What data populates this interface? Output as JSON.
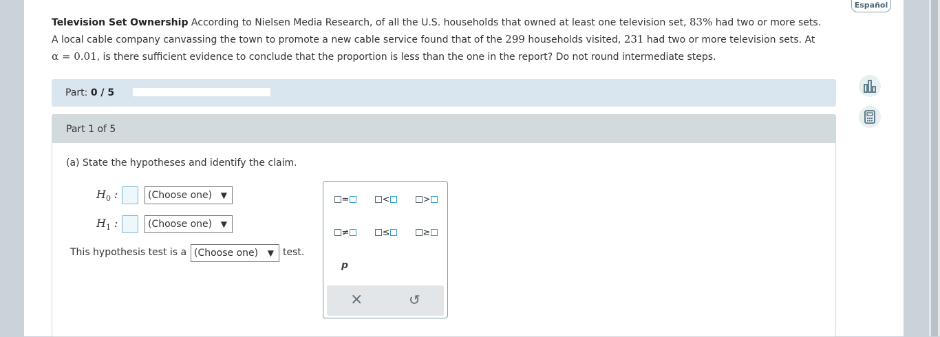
{
  "header": {
    "language_button": "Español"
  },
  "problem": {
    "title": "Television Set Ownership",
    "line1_a": "According to Nielsen Media Research, of all the U.S. households that owned at least one television set,",
    "pct": "83%",
    "line1_b": "had two or more sets.",
    "line2_a": "A local cable company canvassing the town to promote a new cable service found that of the",
    "n": "299",
    "line2_b": "households visited,",
    "x": "231",
    "line2_c": "had two or more television sets. At",
    "alpha": "α = 0.01",
    "line3": ", is there sufficient evidence to conclude that the proportion is less than the one in the report? Do not round intermediate steps."
  },
  "progress": {
    "label": "Part:",
    "value": "0 / 5",
    "fraction": 0
  },
  "section": {
    "title": "Part 1 of 5",
    "question": "(a) State the hypotheses and identify the claim.",
    "h0_label": "H",
    "h0_sub": "0",
    "h1_label": "H",
    "h1_sub": "1",
    "colon": ":",
    "h0_select": "(Choose one)",
    "h1_select": "(Choose one)",
    "test_prefix": "This hypothesis test is a",
    "test_select": "(Choose one)",
    "test_suffix": "test.",
    "select_arrow": "▼"
  },
  "palette": {
    "symbols": [
      "=",
      "<",
      ">",
      "≠",
      "≤",
      "≥"
    ],
    "variable": "p",
    "clear_glyph": "×",
    "undo_glyph": "↺"
  }
}
